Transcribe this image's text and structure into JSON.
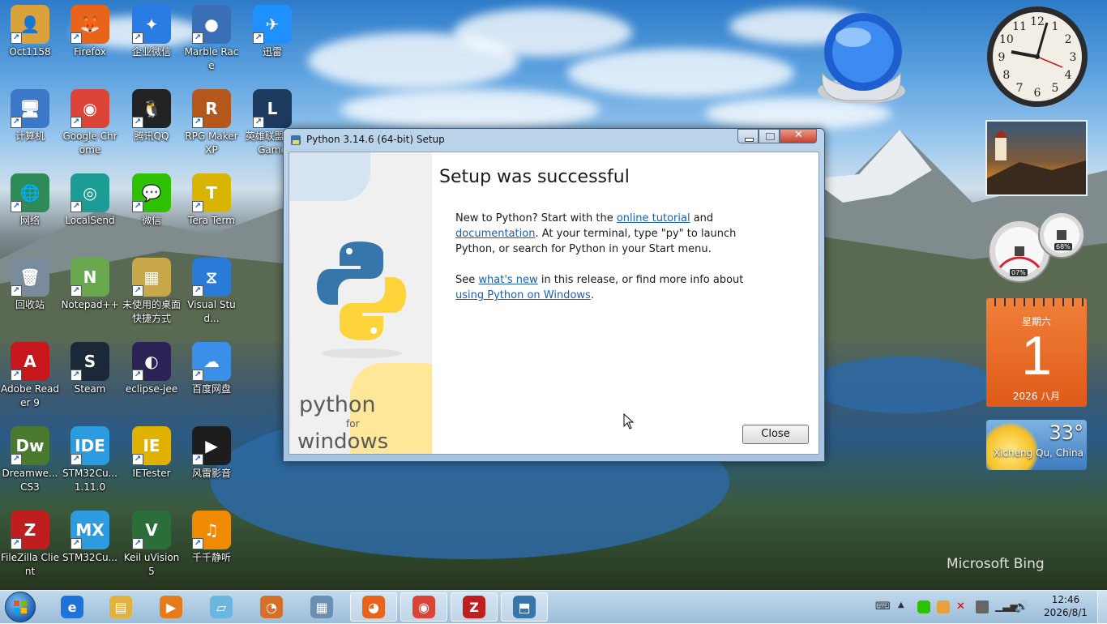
{
  "desktop": {
    "icons": [
      {
        "label": "Oct1158",
        "color": "#d9a23a",
        "glyph": "👤"
      },
      {
        "label": "Firefox",
        "color": "#e8641a",
        "glyph": "🦊"
      },
      {
        "label": "企业微信",
        "color": "#2b7be4",
        "glyph": "✦"
      },
      {
        "label": "Marble Race",
        "color": "#3a6fb8",
        "glyph": "●"
      },
      {
        "label": "迅雷",
        "color": "#1e90ff",
        "glyph": "✈"
      },
      {
        "label": "计算机",
        "color": "#3b78c7",
        "glyph": "🖥"
      },
      {
        "label": "Google Chrome",
        "color": "#db4437",
        "glyph": "◉"
      },
      {
        "label": "腾讯QQ",
        "color": "#222222",
        "glyph": "🐧"
      },
      {
        "label": "RPG Maker XP",
        "color": "#b5561a",
        "glyph": "R"
      },
      {
        "label": "英雄联盟WeGame",
        "color": "#1d3a5f",
        "glyph": "L"
      },
      {
        "label": "网络",
        "color": "#2e8b57",
        "glyph": "🌐"
      },
      {
        "label": "LocalSend",
        "color": "#1b9c95",
        "glyph": "◎"
      },
      {
        "label": "微信",
        "color": "#2dc100",
        "glyph": "💬"
      },
      {
        "label": "Tera Term",
        "color": "#d9b400",
        "glyph": "T"
      },
      {
        "label": "回收站",
        "color": "#7a8c9c",
        "glyph": "🗑"
      },
      {
        "label": "Notepad++",
        "color": "#6aa84f",
        "glyph": "N"
      },
      {
        "label": "未使用的桌面快捷方式",
        "color": "#c9a84a",
        "glyph": "▦"
      },
      {
        "label": "Visual Stud...",
        "color": "#2a7ad8",
        "glyph": "⧖"
      },
      {
        "label": "Adobe Reader 9",
        "color": "#c8161d",
        "glyph": "A"
      },
      {
        "label": "Steam",
        "color": "#1b2838",
        "glyph": "S"
      },
      {
        "label": "eclipse-jee",
        "color": "#2c2255",
        "glyph": "◐"
      },
      {
        "label": "百度网盘",
        "color": "#3b8fe8",
        "glyph": "☁"
      },
      {
        "label": "Dreamwe... CS3",
        "color": "#4a7a2e",
        "glyph": "Dw"
      },
      {
        "label": "STM32Cu... 1.11.0",
        "color": "#2d9be0",
        "glyph": "IDE"
      },
      {
        "label": "IETester",
        "color": "#e1b100",
        "glyph": "IE"
      },
      {
        "label": "风雷影音",
        "color": "#1d1d1d",
        "glyph": "▶"
      },
      {
        "label": "FileZilla Client",
        "color": "#bf1e1e",
        "glyph": "Z"
      },
      {
        "label": "STM32Cu...",
        "color": "#2d9be0",
        "glyph": "MX"
      },
      {
        "label": "Keil uVision5",
        "color": "#2b6e3a",
        "glyph": "V"
      },
      {
        "label": "千千静听",
        "color": "#f08a00",
        "glyph": "♫"
      }
    ],
    "watermark": "Microsoft Bing"
  },
  "gadgets": {
    "clock": {
      "numbers": [
        "12",
        "1",
        "2",
        "3",
        "4",
        "5",
        "6",
        "7",
        "8",
        "9",
        "10",
        "11"
      ]
    },
    "cpu_meter": {
      "cpu": "07%",
      "ram": "68%"
    },
    "calendar": {
      "weekday": "星期六",
      "day": "1",
      "month_year": "2026 八月"
    },
    "weather": {
      "temp": "33°",
      "location": "Xicheng Qu, China"
    }
  },
  "window": {
    "title": "Python 3.14.6 (64-bit) Setup",
    "brand_line1": "python",
    "brand_for": "for",
    "brand_line2": "windows",
    "heading": "Setup was successful",
    "p1_a": "New to Python? Start with the ",
    "p1_link1": "online tutorial",
    "p1_b": " and ",
    "p1_link2": "documentation",
    "p1_c": ". At your terminal, type \"py\" to launch Python, or search for Python in your Start menu.",
    "p2_a": "See ",
    "p2_link1": "what's new",
    "p2_b": " in this release, or find more info about ",
    "p2_link2": "using Python on Windows",
    "p2_c": ".",
    "close_label": "Close"
  },
  "taskbar": {
    "clock_time": "12:46",
    "clock_date": "2026/8/1",
    "apps": [
      {
        "name": "internet-explorer",
        "glyph": "e",
        "color": "#1e73d8"
      },
      {
        "name": "file-explorer",
        "glyph": "▤",
        "color": "#e2b33c"
      },
      {
        "name": "media-player",
        "glyph": "▶",
        "color": "#e77b1a"
      },
      {
        "name": "notes",
        "glyph": "▱",
        "color": "#6cb7e0"
      },
      {
        "name": "paint",
        "glyph": "◔",
        "color": "#d66f2a"
      },
      {
        "name": "calculator",
        "glyph": "▦",
        "color": "#6b8fb2"
      },
      {
        "name": "firefox",
        "glyph": "◕",
        "color": "#e8641a"
      },
      {
        "name": "chrome",
        "glyph": "◉",
        "color": "#db4437"
      },
      {
        "name": "filezilla",
        "glyph": "Z",
        "color": "#bf1e1e"
      },
      {
        "name": "python-setup",
        "glyph": "⬒",
        "color": "#3776ab"
      }
    ]
  }
}
